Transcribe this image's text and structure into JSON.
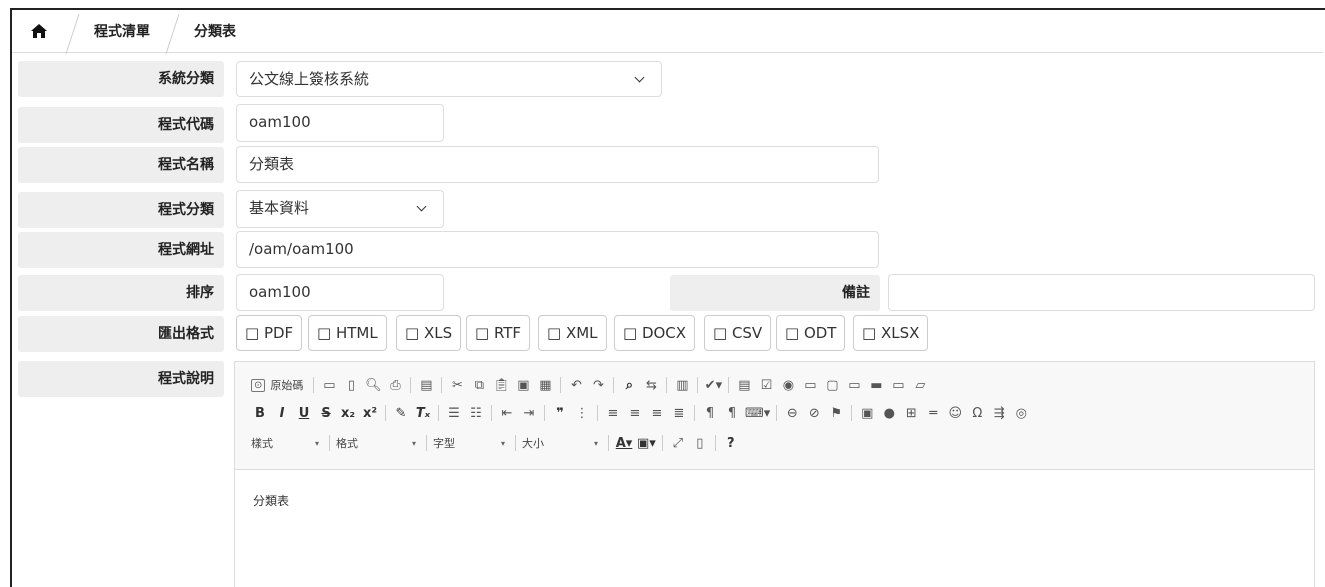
{
  "breadcrumb": {
    "items": [
      "程式清單",
      "分類表"
    ]
  },
  "form": {
    "system_category": {
      "label": "系統分類",
      "value": "公文線上簽核系統"
    },
    "program_code": {
      "label": "程式代碼",
      "value": "oam100"
    },
    "program_name": {
      "label": "程式名稱",
      "value": "分類表"
    },
    "program_type": {
      "label": "程式分類",
      "value": "基本資料"
    },
    "program_url": {
      "label": "程式網址",
      "value": "/oam/oam100"
    },
    "sort": {
      "label": "排序",
      "value": "oam100"
    },
    "remark": {
      "label": "備註",
      "value": ""
    },
    "export_format": {
      "label": "匯出格式",
      "options": [
        "□ PDF",
        "□ HTML",
        "□ XLS",
        "□ RTF",
        "□ XML",
        "□ DOCX",
        "□ CSV",
        "□ ODT",
        "□ XLSX"
      ]
    },
    "description": {
      "label": "程式說明",
      "content": "分類表"
    }
  },
  "editor": {
    "source_label": "原始碼",
    "combos": [
      "樣式",
      "格式",
      "字型",
      "大小"
    ],
    "help": "?"
  },
  "colors": {
    "label_bg": "#eeeeee",
    "border": "#dddddd",
    "toolbar_bg": "#f8f8f8"
  }
}
